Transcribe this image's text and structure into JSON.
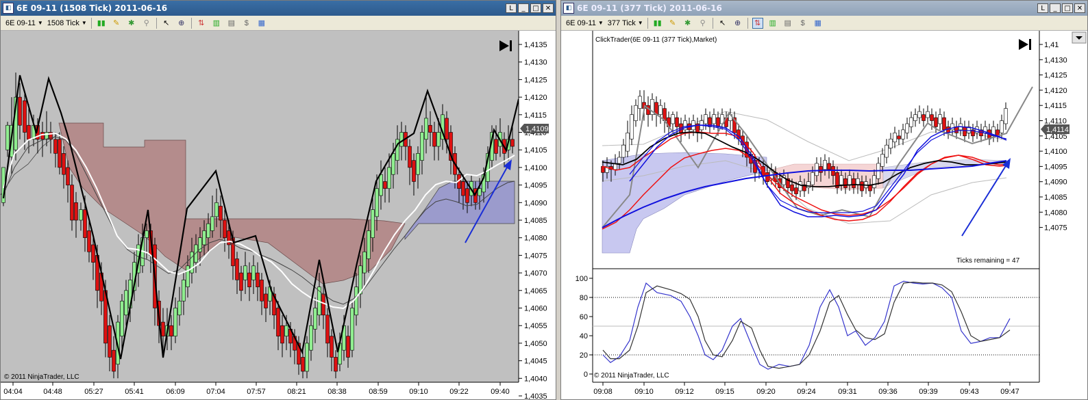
{
  "left": {
    "title": "6E 09-11 (1508 Tick)  2011-06-16",
    "toolbar": {
      "instrument": "6E 09-11",
      "period": "1508 Tick"
    },
    "current_price": "1,4109",
    "copyright": "© 2011 NinjaTrader, LLC",
    "y_labels": [
      "1,4135",
      "1,4130",
      "1,4125",
      "1,4120",
      "1,4115",
      "1,4110",
      "1,4105",
      "1,4100",
      "1,4095",
      "1,4090",
      "1,4085",
      "1,4080",
      "1,4075",
      "1,4070",
      "1,4065",
      "1,4060",
      "1,4055",
      "1,4050",
      "1,4045",
      "1,4040",
      "1,4035"
    ],
    "x_labels": [
      "04:04",
      "04:48",
      "05:27",
      "05:41",
      "06:09",
      "07:04",
      "07:57",
      "08:21",
      "08:38",
      "08:59",
      "09:10",
      "09:22",
      "09:40"
    ],
    "colors": {
      "bg": "#c0c0c0",
      "up": "#90ee90",
      "down": "#dd1111",
      "cloud_red": "#b48c8c",
      "cloud_blue": "#9b9bcc",
      "zigzag": "#000000",
      "ma": "#ffffff",
      "arrow": "#1a2ed6"
    }
  },
  "right": {
    "title": "6E 09-11 (377 Tick)  2011-06-16",
    "toolbar": {
      "instrument": "6E 09-11",
      "period": "377 Tick"
    },
    "header_label": "ClickTrader(6E 09-11 (377 Tick),Market)",
    "current_price": "1,4114",
    "ticks_remaining": "Ticks remaining = 47",
    "copyright": "© 2011 NinjaTrader, LLC",
    "y_labels": [
      "1,41",
      "1,4130",
      "1,4125",
      "1,4120",
      "1,4115",
      "1,4110",
      "1,4105",
      "1,4100",
      "1,4095",
      "1,4090",
      "1,4085",
      "1,4080",
      "1,4075"
    ],
    "osc_labels": [
      "100",
      "80",
      "60",
      "40",
      "20",
      "0"
    ],
    "x_labels": [
      "09:08",
      "09:10",
      "09:12",
      "09:15",
      "09:20",
      "09:24",
      "09:31",
      "09:36",
      "09:39",
      "09:43",
      "09:47"
    ],
    "colors": {
      "bg": "#ffffff",
      "up": "#ffffff",
      "down": "#dd1111",
      "cloud_red": "#f5d5d5",
      "cloud_blue": "#c8c8f0",
      "blue_line": "#1010dd",
      "red_line": "#ee1111",
      "arrow": "#1a2ed6"
    }
  },
  "icons": [
    "bars-icon",
    "pencil-icon",
    "magnet-icon",
    "pointer-icon",
    "zoom-icon",
    "strategy-icon",
    "chart-style-icon",
    "data-icon",
    "properties-icon"
  ]
}
